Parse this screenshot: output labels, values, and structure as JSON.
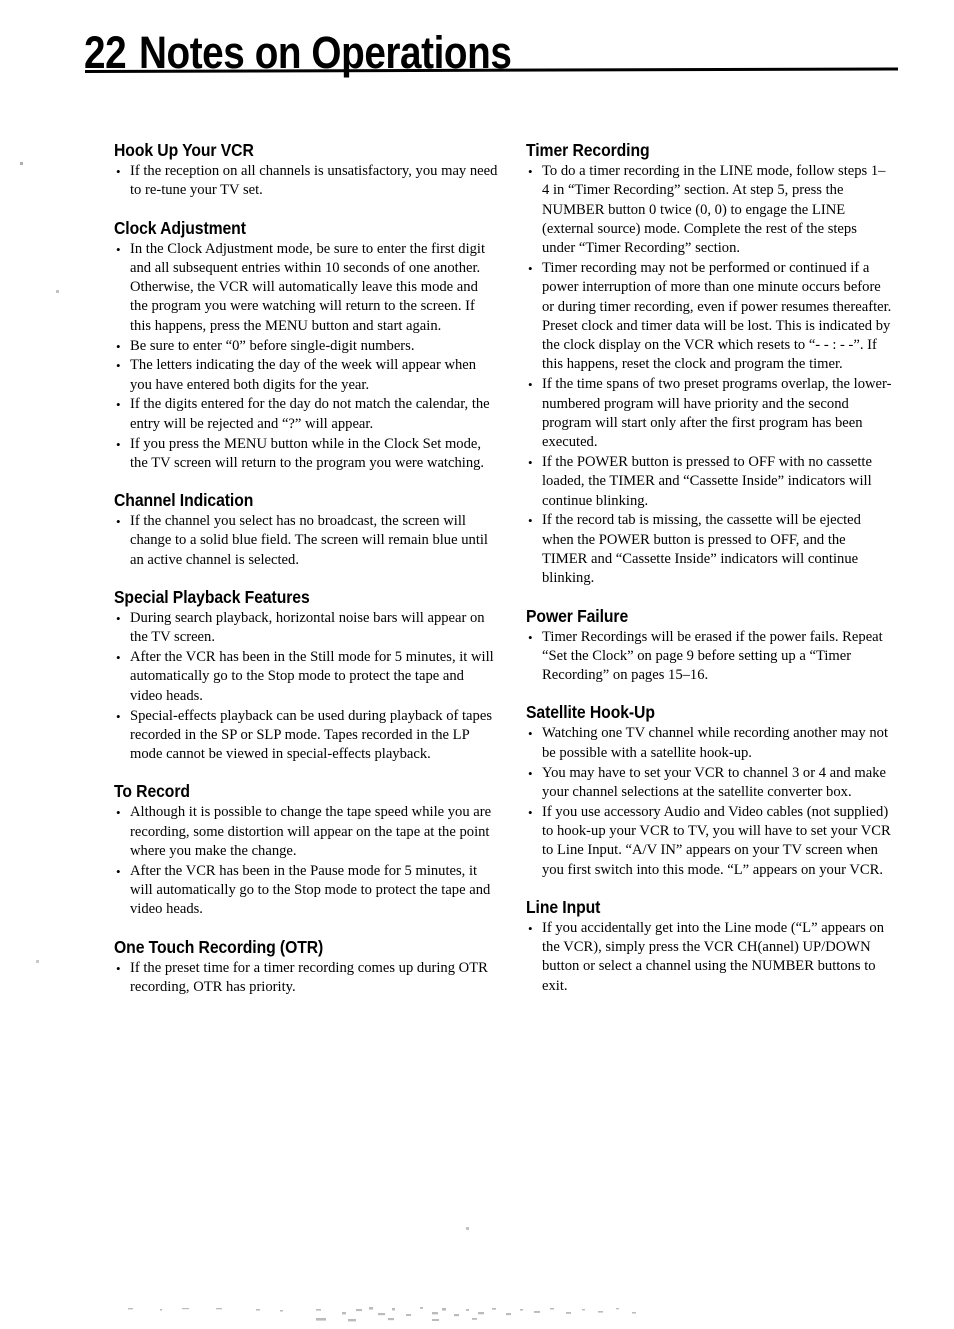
{
  "page": {
    "number": "22",
    "title": "Notes on Operations"
  },
  "columns": {
    "left": [
      {
        "heading": "Hook Up Your VCR",
        "bullets": [
          "If the reception on all channels is unsatisfactory, you may need to re-tune your TV set."
        ]
      },
      {
        "heading": "Clock Adjustment",
        "bullets": [
          "In the Clock Adjustment mode, be sure to enter the first digit and all subsequent entries within 10 seconds of one another. Otherwise, the VCR will automatically leave this mode and the program you were watching will return to the screen. If this happens, press the MENU button and start again.",
          "Be sure to enter “0” before single-digit numbers.",
          "The letters indicating the day of the week will appear when you have entered both digits for the year.",
          "If the digits entered for the day do not match the calendar, the entry will be rejected and “?” will appear.",
          "If you press the MENU button while in the Clock Set mode, the TV screen will return to the program you were watching."
        ]
      },
      {
        "heading": "Channel Indication",
        "bullets": [
          "If the channel you select has no broadcast, the screen will change to a solid blue field. The screen will remain blue until an active channel is selected."
        ]
      },
      {
        "heading": "Special Playback Features",
        "bullets": [
          "During search playback, horizontal noise bars will appear on the TV screen.",
          "After the VCR has been in the Still mode for 5 minutes, it will automatically go to the Stop mode to protect the tape and video heads.",
          "Special-effects playback can be used during playback of tapes recorded in the SP or SLP mode. Tapes recorded in the LP mode cannot be viewed in special-effects playback."
        ]
      },
      {
        "heading": "To Record",
        "bullets": [
          "Although it is possible to change the tape speed while you are recording, some distortion will appear on the tape at the point where you make the change.",
          "After the VCR has been in the Pause mode for 5 minutes, it will automatically go to the Stop mode to protect the tape and video heads."
        ]
      },
      {
        "heading": "One Touch Recording (OTR)",
        "bullets": [
          "If the preset time for a timer recording comes up during OTR recording, OTR has priority."
        ]
      }
    ],
    "right": [
      {
        "heading": "Timer Recording",
        "bullets": [
          "To do a timer recording in the LINE mode, follow steps 1– 4 in “Timer Recording” section. At step 5, press the NUMBER button 0 twice (0, 0) to engage the LINE (external source) mode. Complete the rest of the steps under “Timer Recording” section.",
          "Timer recording may not be performed or continued if a power interruption of more than one minute occurs before or during timer recording, even if power resumes thereafter. Preset clock and timer data will be lost. This is indicated by the clock display on the VCR which resets to “- - : - -”. If this happens, reset the clock and program the timer.",
          "If the time spans of two preset programs overlap, the lower-numbered program will have priority and the second program will start only after the first program has been executed.",
          "If the POWER button is pressed to OFF with no cassette loaded, the TIMER and “Cassette Inside” indicators will continue blinking.",
          "If the record tab is missing, the cassette will be ejected when the POWER button is pressed to OFF, and the TIMER and “Cassette Inside” indicators will continue blinking."
        ]
      },
      {
        "heading": "Power Failure",
        "bullets": [
          "Timer Recordings will be erased if the power fails. Repeat “Set the Clock” on page 9 before setting up a “Timer Recording” on pages 15–16."
        ]
      },
      {
        "heading": "Satellite Hook-Up",
        "bullets": [
          "Watching one TV channel while recording another may not be possible with a satellite hook-up.",
          "You may have to set your VCR to channel 3 or 4 and make your channel selections at the satellite converter box.",
          "If you use accessory Audio and Video cables (not supplied) to hook-up your VCR to TV, you will have to set your VCR to Line Input. “A/V IN” appears on your TV screen when you first switch into this mode. “L” appears on your VCR."
        ]
      },
      {
        "heading": "Line Input",
        "bullets": [
          "If you accidentally get into the Line mode (“L” appears on the VCR), simply press the VCR CH(annel) UP/DOWN button or select a channel using the NUMBER buttons to exit."
        ]
      }
    ]
  },
  "bullet_glyph": "•",
  "colors": {
    "text": "#000000",
    "page_background": "#ffffff",
    "rule": "#000000"
  }
}
